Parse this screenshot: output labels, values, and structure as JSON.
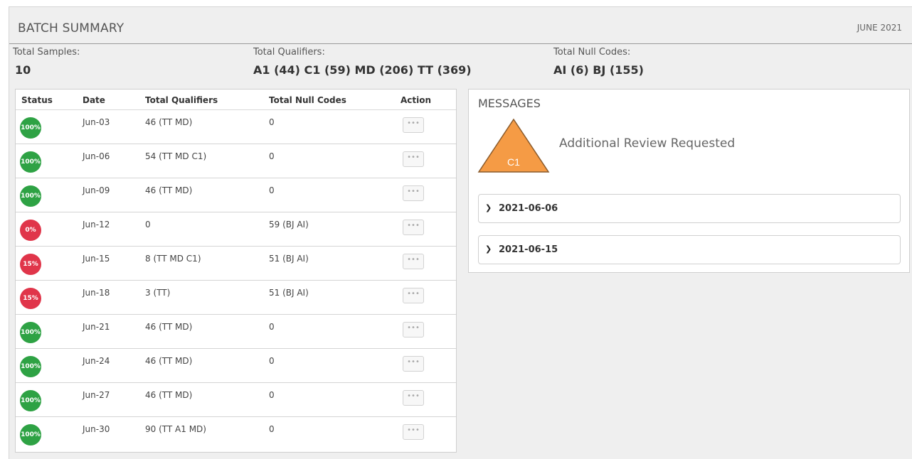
{
  "header": {
    "title": "BATCH SUMMARY",
    "period": "JUNE 2021"
  },
  "stats": {
    "samples": {
      "label": "Total Samples:",
      "value": "10"
    },
    "qualifiers": {
      "label": "Total Qualifiers:",
      "value": "A1 (44) C1 (59) MD (206) TT (369)"
    },
    "null_codes": {
      "label": "Total Null Codes:",
      "value": "AI (6) BJ (155)"
    }
  },
  "table": {
    "columns": [
      "Status",
      "Date",
      "Total Qualifiers",
      "Total Null Codes",
      "Action"
    ],
    "action_label": "•••",
    "rows": [
      {
        "status": "100%",
        "level": "ok",
        "date": "Jun-03",
        "qualifiers": "46 (TT MD)",
        "null_codes": "0"
      },
      {
        "status": "100%",
        "level": "ok",
        "date": "Jun-06",
        "qualifiers": "54 (TT MD C1)",
        "null_codes": "0"
      },
      {
        "status": "100%",
        "level": "ok",
        "date": "Jun-09",
        "qualifiers": "46 (TT MD)",
        "null_codes": "0"
      },
      {
        "status": "0%",
        "level": "bad",
        "date": "Jun-12",
        "qualifiers": "0",
        "null_codes": "59 (BJ AI)"
      },
      {
        "status": "15%",
        "level": "bad",
        "date": "Jun-15",
        "qualifiers": "8 (TT MD C1)",
        "null_codes": "51 (BJ AI)"
      },
      {
        "status": "15%",
        "level": "bad",
        "date": "Jun-18",
        "qualifiers": "3 (TT)",
        "null_codes": "51 (BJ AI)"
      },
      {
        "status": "100%",
        "level": "ok",
        "date": "Jun-21",
        "qualifiers": "46 (TT MD)",
        "null_codes": "0"
      },
      {
        "status": "100%",
        "level": "ok",
        "date": "Jun-24",
        "qualifiers": "46 (TT MD)",
        "null_codes": "0"
      },
      {
        "status": "100%",
        "level": "ok",
        "date": "Jun-27",
        "qualifiers": "46 (TT MD)",
        "null_codes": "0"
      },
      {
        "status": "100%",
        "level": "ok",
        "date": "Jun-30",
        "qualifiers": "90 (TT A1 MD)",
        "null_codes": "0"
      }
    ]
  },
  "messages": {
    "title": "MESSAGES",
    "warning": {
      "code": "C1",
      "text": "Additional Review Requested",
      "icon": "warning-triangle-icon"
    },
    "entries": [
      "2021-06-06",
      "2021-06-15"
    ]
  },
  "colors": {
    "status_ok": "#2ea244",
    "status_bad": "#e0354a",
    "warning": "#f59b45"
  }
}
